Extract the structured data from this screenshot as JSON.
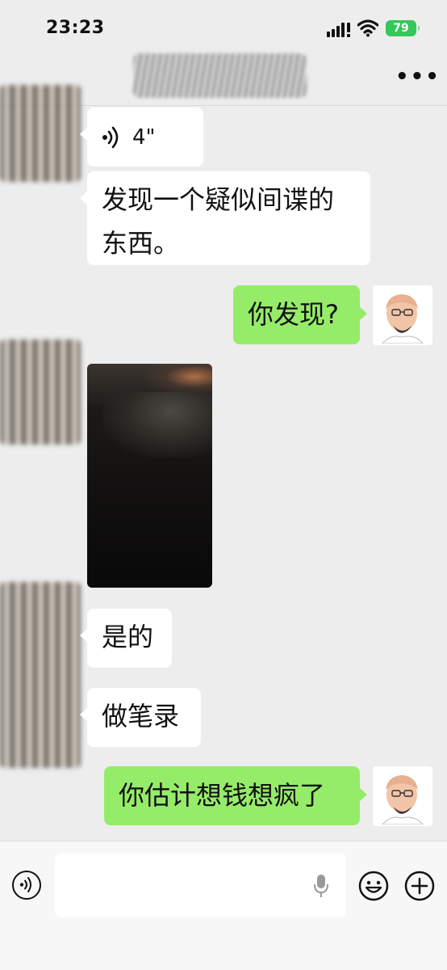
{
  "status_bar": {
    "time": "23:23",
    "battery": "79"
  },
  "nav": {
    "more": "•••"
  },
  "messages": [
    {
      "type": "voice",
      "side": "left",
      "duration": "4\""
    },
    {
      "type": "text",
      "side": "left",
      "text": "发现一个疑似间谍的东西。"
    },
    {
      "type": "text",
      "side": "right",
      "text": "你发现?"
    },
    {
      "type": "image",
      "side": "left"
    },
    {
      "type": "text",
      "side": "left",
      "text": "是的"
    },
    {
      "type": "text",
      "side": "left",
      "text": "做笔录"
    },
    {
      "type": "text",
      "side": "right",
      "text": "你估计想钱想疯了"
    }
  ],
  "input_bar": {
    "placeholder": ""
  },
  "colors": {
    "background": "#ededed",
    "outgoing_bubble": "#95ec69",
    "incoming_bubble": "#ffffff",
    "battery": "#34c759"
  }
}
